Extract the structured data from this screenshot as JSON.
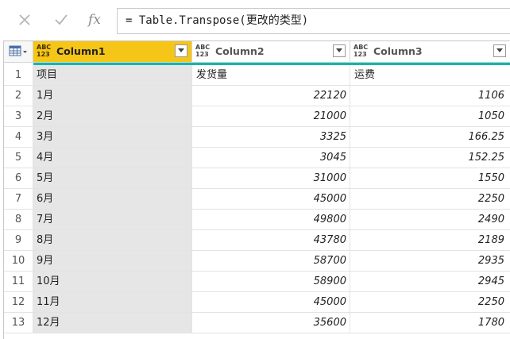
{
  "formula_bar": {
    "cancel_icon": "close-icon",
    "commit_icon": "check-icon",
    "fx_label": "fx",
    "formula": "= Table.Transpose(更改的类型)"
  },
  "columns": [
    {
      "type_top": "ABC",
      "type_bottom": "123",
      "name": "Column1",
      "selected": true
    },
    {
      "type_top": "ABC",
      "type_bottom": "123",
      "name": "Column2",
      "selected": false
    },
    {
      "type_top": "ABC",
      "type_bottom": "123",
      "name": "Column3",
      "selected": false
    }
  ],
  "rows": [
    {
      "n": "1",
      "c1": "项目",
      "c2": "发货量",
      "c3": "运费",
      "text": true
    },
    {
      "n": "2",
      "c1": "1月",
      "c2": "22120",
      "c3": "1106"
    },
    {
      "n": "3",
      "c1": "2月",
      "c2": "21000",
      "c3": "1050"
    },
    {
      "n": "4",
      "c1": "3月",
      "c2": "3325",
      "c3": "166.25"
    },
    {
      "n": "5",
      "c1": "4月",
      "c2": "3045",
      "c3": "152.25"
    },
    {
      "n": "6",
      "c1": "5月",
      "c2": "31000",
      "c3": "1550"
    },
    {
      "n": "7",
      "c1": "6月",
      "c2": "45000",
      "c3": "2250"
    },
    {
      "n": "8",
      "c1": "7月",
      "c2": "49800",
      "c3": "2490"
    },
    {
      "n": "9",
      "c1": "8月",
      "c2": "43780",
      "c3": "2189"
    },
    {
      "n": "10",
      "c1": "9月",
      "c2": "58700",
      "c3": "2935"
    },
    {
      "n": "11",
      "c1": "10月",
      "c2": "58900",
      "c3": "2945"
    },
    {
      "n": "12",
      "c1": "11月",
      "c2": "45000",
      "c3": "2250"
    },
    {
      "n": "13",
      "c1": "12月",
      "c2": "35600",
      "c3": "1780"
    }
  ],
  "colors": {
    "selected_header": "#f5c518",
    "quality_strip": "#01b8aa",
    "selected_column_bg": "#e6e6e6"
  }
}
